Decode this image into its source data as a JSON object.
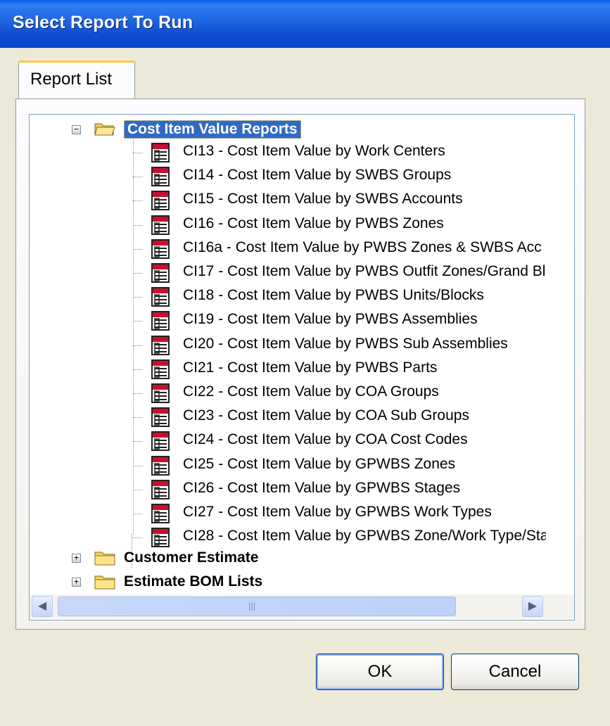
{
  "window": {
    "title": "Select Report To Run"
  },
  "tabs": [
    {
      "label": "Report List",
      "selected": true
    }
  ],
  "tree": {
    "group": {
      "label": "Cost Item Value Reports",
      "expanded": true,
      "selected": true
    },
    "reports": [
      "CI13 - Cost Item Value by Work Centers",
      "CI14 - Cost Item Value by SWBS Groups",
      "CI15 - Cost Item Value by SWBS Accounts",
      "CI16 - Cost Item Value by PWBS Zones",
      "CI16a - Cost Item Value by PWBS Zones & SWBS Acc",
      "CI17 - Cost Item Value by PWBS Outfit Zones/Grand Bl",
      "CI18 - Cost Item Value by PWBS Units/Blocks",
      "CI19 - Cost Item Value by PWBS Assemblies",
      "CI20 - Cost Item Value by PWBS Sub Assemblies",
      "CI21 - Cost Item Value by PWBS Parts",
      "CI22 - Cost Item Value by COA Groups",
      "CI23 - Cost Item Value by COA Sub Groups",
      "CI24 - Cost Item Value by COA Cost Codes",
      "CI25 - Cost Item Value by GPWBS Zones",
      "CI26 - Cost Item Value by GPWBS Stages",
      "CI27 - Cost Item Value by GPWBS Work Types",
      "CI28 - Cost Item Value by GPWBS Zone/Work Type/Sta"
    ],
    "collapsed_groups": [
      "Customer Estimate",
      "Estimate BOM Lists"
    ],
    "expander_expanded": "−",
    "expander_collapsed": "+"
  },
  "scrollbars": {
    "up": "▲",
    "down": "▼",
    "left": "◀",
    "right": "▶",
    "grip": "|||",
    "vgrip": "≡"
  },
  "buttons": {
    "ok": "OK",
    "cancel": "Cancel"
  },
  "icons": {
    "folder": "folder-icon",
    "report": "report-icon"
  }
}
